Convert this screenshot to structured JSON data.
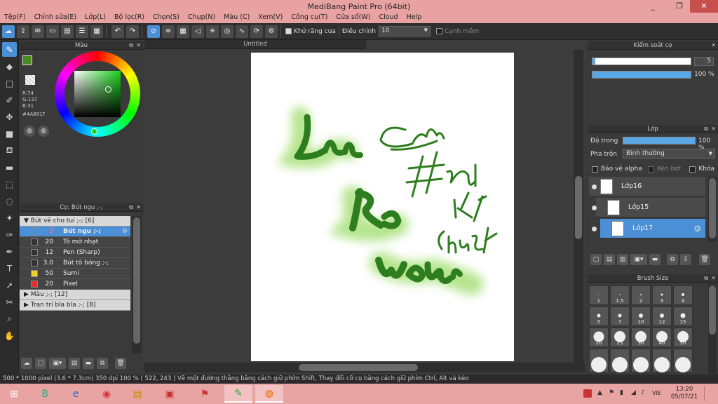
{
  "app": {
    "title": "MediBang Paint Pro (64bit)",
    "minimize": "_",
    "maximize": "❐",
    "close": "✕"
  },
  "menu": [
    "Tệp(F)",
    "Chỉnh sửa(E)",
    "Lớp(L)",
    "Bộ lọc(R)",
    "Chọn(S)",
    "Chụp(N)",
    "Màu (C)",
    "Xem(V)",
    "Công cụ(T)",
    "Cửa sổ(W)",
    "Cloud",
    "Help"
  ],
  "toolbar": {
    "antialias_label": "Khử răng cưa",
    "adjust_label": "Điều chỉnh",
    "adjust_value": "10",
    "edge_label": "Cạnh mềm"
  },
  "canvas_tab": "Untitled",
  "color_panel": {
    "title": "Màu",
    "rgb": {
      "r": "R:74",
      "g": "G:137",
      "b": "B:31"
    },
    "hex": "#4A891F",
    "primary_color": "#4A891F",
    "secondary_color": "#a9c4e8"
  },
  "brush_panel": {
    "title": "Cọ: Bút ngu ;-;",
    "groups": [
      {
        "label": "Bút vẽ cho tui ;-; [6]",
        "expanded": true
      },
      {
        "label": "Màu ;-; [12]",
        "expanded": false
      },
      {
        "label": "Tran trí bla bla ;-; [8]",
        "expanded": false
      }
    ],
    "brushes": [
      {
        "size": "5",
        "name": "Bút ngu ;-;",
        "swatch": "#4b8fd6",
        "selected": true
      },
      {
        "size": "20",
        "name": "Tô mờ nhạt",
        "swatch": "#333333",
        "selected": false
      },
      {
        "size": "12",
        "name": "Pen (Sharp)",
        "swatch": "#333333",
        "selected": false
      },
      {
        "size": "3.0",
        "name": "Bút tô bóng ;-;",
        "swatch": "#333333",
        "selected": false
      },
      {
        "size": "50",
        "name": "Sumi",
        "swatch": "#f0d020",
        "selected": false
      },
      {
        "size": "20",
        "name": "Pixel",
        "swatch": "#e03030",
        "selected": false
      }
    ]
  },
  "brush_control": {
    "title": "Kiểm soát cọ",
    "size_value": "5",
    "opacity_value": "100 %",
    "size_fraction": 0.03,
    "opacity_fraction": 1.0
  },
  "layer_panel": {
    "title": "Lớp",
    "opacity_label": "Độ trong",
    "opacity_value": "100 %",
    "blend_label": "Pha trộn",
    "blend_value": "Bình thường",
    "protect_alpha": "Bảo vệ alpha",
    "clipping": "Xén bớt",
    "lock": "Khóa",
    "layers": [
      {
        "name": "Lớp16",
        "selected": false
      },
      {
        "name": "Lớp15",
        "selected": false
      },
      {
        "name": "Lớp17",
        "selected": true
      }
    ]
  },
  "brush_size_panel": {
    "title": "Brush Size",
    "sizes": [
      "1",
      "1.5",
      "2",
      "3",
      "4",
      "5",
      "7",
      "10",
      "12",
      "15",
      "20",
      "25",
      "30",
      "40",
      "50"
    ]
  },
  "artwork": {
    "words": [
      "Lee",
      "Ro",
      "Won",
      "Chung",
      "#Hackr",
      "KT",
      "chungkkT"
    ],
    "ink_color": "#2e7d1e",
    "glow_color": "#a8e07a"
  },
  "status": "500 * 1000 pixel  (3.6 * 7.3cm)  350 dpi  100 %  ( 522, 243 )  Vẽ một đường thẳng bằng cách giữ phím Shift, Thay đổi cỡ cọ bằng cách giữ phím Ctrl, Alt và kéo",
  "taskbar": {
    "start_icon": "⊞",
    "apps": [
      "B",
      "e",
      "◉",
      "▤",
      "▣",
      "⚑",
      "✎",
      "◍"
    ],
    "lang": "VIE",
    "time": "13:20",
    "date": "05/07/21"
  }
}
